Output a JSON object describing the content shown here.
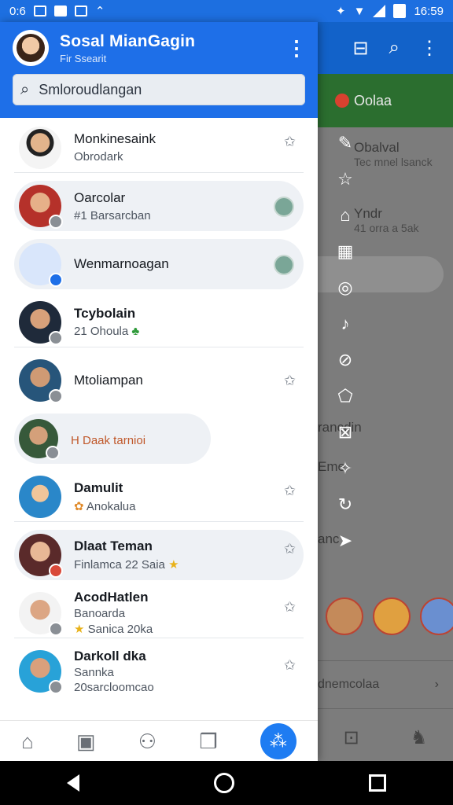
{
  "status": {
    "left_text": "0:6",
    "time": "16:59"
  },
  "drawer": {
    "title": "Sosal MianGagin",
    "subtitle": "Fir Ssearit",
    "search_placeholder": "Smloroudlangan"
  },
  "items": [
    {
      "name": "Monkinesaink",
      "sub": "Obrodark",
      "style": "row",
      "action": "star"
    },
    {
      "name": "Oarcolar",
      "sub": "#1 Barsarcban",
      "style": "pill",
      "action": "timer"
    },
    {
      "name": "Wenmarnoagan",
      "sub": "",
      "style": "pill",
      "action": "timer"
    },
    {
      "name": "Tcybolain",
      "sub": "21 Ohoula",
      "style": "row",
      "action": ""
    },
    {
      "name": "Mtoliampan",
      "sub": "",
      "style": "row",
      "action": "star"
    },
    {
      "name": "",
      "sub": "H Daak tarnioi",
      "style": "pill",
      "action": ""
    },
    {
      "name": "Damulit",
      "sub": "Anokalua",
      "style": "row",
      "action": "star"
    },
    {
      "name": "Dlaat Teman",
      "sub": "Finlamca 22 Saia",
      "style": "pill",
      "action": "star"
    },
    {
      "name": "AcodHatlen",
      "sub": "Banoarda",
      "sub2": "Sanica 20ka",
      "style": "row",
      "action": "star"
    },
    {
      "name": "Darkoll dka",
      "sub": "Sannka",
      "sub2": "20sarcloomcao",
      "style": "row",
      "action": "star"
    }
  ],
  "background": {
    "green_label": "Oolaa",
    "rows": [
      "Obalval",
      "Tec mnel lsanck",
      "Yndr",
      "41 orra a 5ak",
      "rancdin",
      "Eme",
      "anc",
      "dnemcolaa"
    ]
  },
  "colors": {
    "accent": "#1e6fe8",
    "fab": "#1e7cf2"
  },
  "icons": {
    "search": "search-icon",
    "menu": "more-vert-icon",
    "star": "star-icon"
  }
}
